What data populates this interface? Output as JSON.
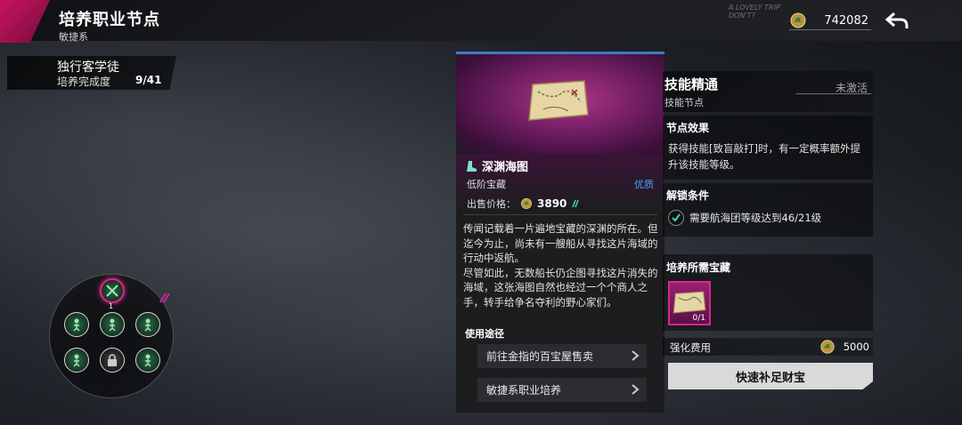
{
  "header": {
    "title": "培养职业节点",
    "subtitle": "敏捷系",
    "logo_text": "A LOVELY TRIP DON'T?",
    "currency_value": "742082",
    "currency_icon": "dragon-coin-icon",
    "back_icon": "back-arrow-icon"
  },
  "progress": {
    "name": "独行客学徒",
    "label": "培养完成度",
    "value": "9/41"
  },
  "skill_tree": {
    "nodes": [
      {
        "icon": "crossed-swords-icon",
        "state": "selected"
      },
      {
        "icon": "figure-icon",
        "state": "active"
      },
      {
        "icon": "figure-icon",
        "state": "active"
      },
      {
        "icon": "figure-icon",
        "state": "active"
      },
      {
        "icon": "figure-icon",
        "state": "active"
      },
      {
        "icon": "lock-icon",
        "state": "locked"
      },
      {
        "icon": "figure-icon",
        "state": "active"
      }
    ],
    "selected_node_level": "1"
  },
  "item": {
    "name": "深渊海图",
    "type": "低阶宝藏",
    "quality": "优质",
    "quality_color": "#4fa0f0",
    "price_label": "出售价格：",
    "price_value": "3890",
    "description": "传闻记载着一片遍地宝藏的深渊的所在。但迄今为止，尚未有一艘船从寻找这片海域的行动中返航。\n尽管如此，无数船长仍企图寻找这片消失的海域，这张海图自然也经过一个个商人之手，转手给争名夺利的野心家们。",
    "usage_title": "使用途径",
    "usages": [
      {
        "label": "前往金指的百宝屋售卖"
      },
      {
        "label": "敏捷系职业培养"
      }
    ]
  },
  "skill": {
    "name": "技能精通",
    "status": "未激活",
    "subtitle": "技能节点",
    "effect_title": "节点效果",
    "effect_text": "获得技能[致盲敲打]时，有一定概率额外提升该技能等级。",
    "unlock_title": "解锁条件",
    "unlock_condition": "需要航海团等级达到46/21级",
    "treasure_title": "培养所需宝藏",
    "treasure_count": "0/1",
    "cost_label": "强化费用",
    "cost_value": "5000",
    "refill_button": "快速补足财宝"
  }
}
